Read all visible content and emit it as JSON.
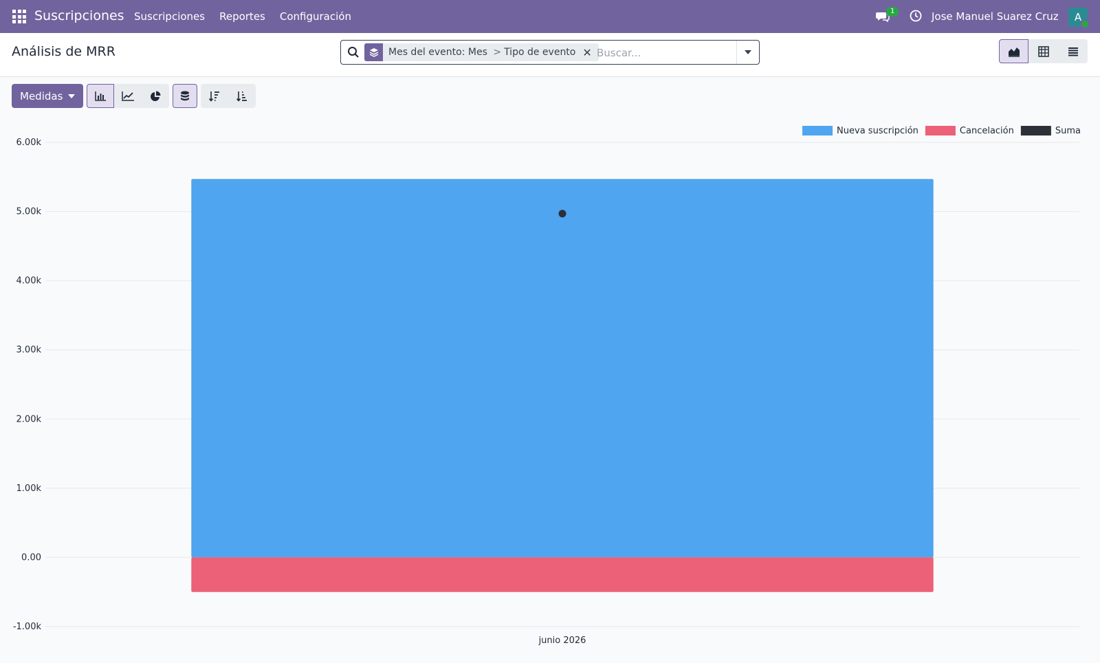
{
  "navbar": {
    "app_name": "Suscripciones",
    "menu": [
      "Suscripciones",
      "Reportes",
      "Configuración"
    ],
    "messages_count": "1",
    "user_name": "Jose Manuel Suarez Cruz",
    "avatar_letter": "A",
    "bg_color": "#71639e"
  },
  "control": {
    "title": "Análisis de MRR",
    "search": {
      "facet_field": "Mes del evento: Mes",
      "facet_separator": ">",
      "facet_value": "Tipo de evento",
      "placeholder": "Buscar..."
    },
    "views": [
      "graph",
      "pivot",
      "list"
    ],
    "active_view": "graph"
  },
  "toolbar": {
    "measures_label": "Medidas",
    "chart_types": [
      "bar",
      "line",
      "pie"
    ],
    "active_chart_type": "bar",
    "stacked": true,
    "sort_buttons": [
      "descending",
      "ascending"
    ]
  },
  "chart_data": {
    "type": "bar",
    "stacked": true,
    "categories": [
      "junio 2026"
    ],
    "series": [
      {
        "name": "Nueva suscripción",
        "values": [
          5470
        ],
        "color": "#4fa5ef"
      },
      {
        "name": "Cancelación",
        "values": [
          -500
        ],
        "color": "#ec6078"
      },
      {
        "name": "Suma",
        "values": [
          4970
        ],
        "color": "#2c3038",
        "render": "point"
      }
    ],
    "ylim": [
      -1000,
      6000
    ],
    "yticks": [
      -1000,
      0,
      1000,
      2000,
      3000,
      4000,
      5000,
      6000
    ],
    "ytick_labels": [
      "-1.00k",
      "0.00",
      "1.00k",
      "2.00k",
      "3.00k",
      "4.00k",
      "5.00k",
      "6.00k"
    ],
    "grid": true,
    "legend_position": "top-right",
    "title": "",
    "xlabel": "",
    "ylabel": ""
  }
}
